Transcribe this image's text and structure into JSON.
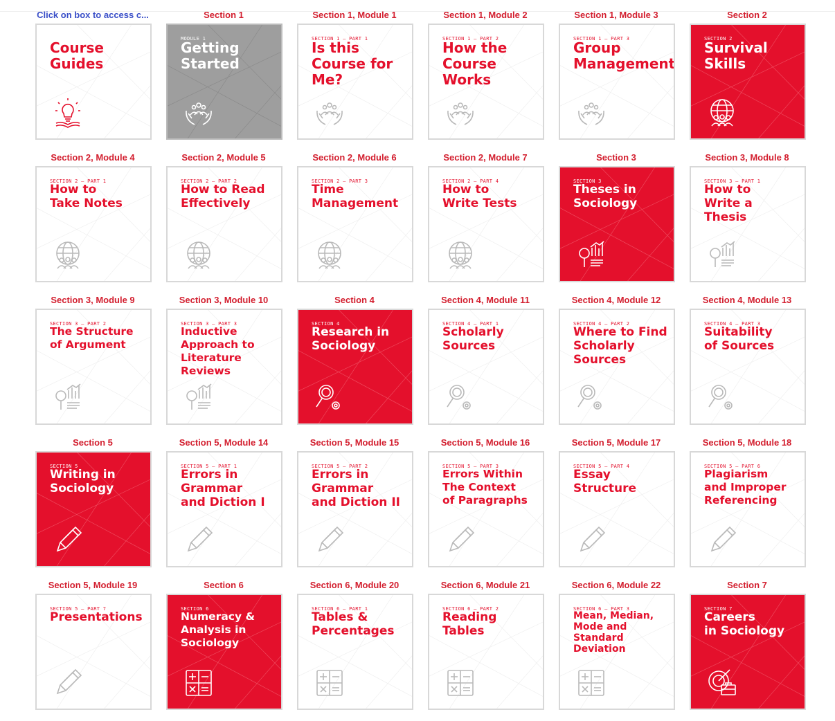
{
  "header_link": "Click on box to access c...",
  "icon_colors": {
    "red": "#e4102c",
    "light": "#b9b9b9",
    "white": "#ffffff"
  },
  "cells": [
    {
      "label": "Click on box to access c...",
      "kicker": "",
      "title": "Course\nGuides",
      "style": "white",
      "icon": "lightbulb-book-icon",
      "size": "big"
    },
    {
      "label": "Section 1",
      "kicker": "MODULE 1",
      "title": "Getting\nStarted",
      "style": "grey",
      "icon": "people-hands-icon",
      "size": "big"
    },
    {
      "label": "Section 1, Module 1",
      "kicker": "SECTION 1 – PART 1",
      "title": "Is this\nCourse for\nMe?",
      "style": "white",
      "icon": "people-hands-icon",
      "size": "big"
    },
    {
      "label": "Section 1, Module 2",
      "kicker": "SECTION 1 – PART 2",
      "title": "How the\nCourse\nWorks",
      "style": "white",
      "icon": "people-hands-icon",
      "size": "big"
    },
    {
      "label": "Section 1, Module 3",
      "kicker": "SECTION 1 – PART 3",
      "title": "Group\nManagement",
      "style": "white",
      "icon": "people-hands-icon",
      "size": "big"
    },
    {
      "label": "Section 2",
      "kicker": "SECTION 2",
      "title": "Survival\nSkills",
      "style": "red",
      "icon": "globe-people-icon",
      "size": "big"
    },
    {
      "label": "Section 2, Module 4",
      "kicker": "SECTION 2 – PART 1",
      "title": "How to\nTake Notes",
      "style": "white",
      "icon": "globe-people-icon",
      "size": "md"
    },
    {
      "label": "Section 2, Module 5",
      "kicker": "SECTION 2 – PART 2",
      "title": "How to Read\nEffectively",
      "style": "white",
      "icon": "globe-people-icon",
      "size": "md"
    },
    {
      "label": "Section 2, Module 6",
      "kicker": "SECTION 2 – PART 3",
      "title": "Time\nManagement",
      "style": "white",
      "icon": "globe-people-icon",
      "size": "md"
    },
    {
      "label": "Section 2, Module 7",
      "kicker": "SECTION 2 – PART 4",
      "title": "How to\nWrite Tests",
      "style": "white",
      "icon": "globe-people-icon",
      "size": "md"
    },
    {
      "label": "Section 3",
      "kicker": "SECTION 3",
      "title": "Theses in\nSociology",
      "style": "red",
      "icon": "magnifier-chart-icon",
      "size": "md"
    },
    {
      "label": "Section 3, Module 8",
      "kicker": "SECTION 3 – PART 1",
      "title": "How to\nWrite a\nThesis",
      "style": "white",
      "icon": "magnifier-chart-icon",
      "size": "md"
    },
    {
      "label": "Section 3, Module 9",
      "kicker": "SECTION 3 – PART 2",
      "title": "The Structure\nof Argument",
      "style": "white",
      "icon": "magnifier-chart-icon",
      "size": "sm"
    },
    {
      "label": "Section 3, Module 10",
      "kicker": "SECTION 3 – PART 3",
      "title": "Inductive\nApproach to\nLiterature\nReviews",
      "style": "white",
      "icon": "magnifier-chart-icon",
      "size": "sm"
    },
    {
      "label": "Section 4",
      "kicker": "SECTION 4",
      "title": "Research in\nSociology",
      "style": "red",
      "icon": "magnifier-gear-icon",
      "size": "md"
    },
    {
      "label": "Section 4, Module 11",
      "kicker": "SECTION 4 – PART 1",
      "title": "Scholarly\nSources",
      "style": "white",
      "icon": "magnifier-gear-icon",
      "size": "md"
    },
    {
      "label": "Section 4, Module 12",
      "kicker": "SECTION 4 – PART 2",
      "title": "Where to Find\nScholarly\nSources",
      "style": "white",
      "icon": "magnifier-gear-icon",
      "size": "md"
    },
    {
      "label": "Section 4, Module 13",
      "kicker": "SECTION 4 – PART 3",
      "title": "Suitability\nof Sources",
      "style": "white",
      "icon": "magnifier-gear-icon",
      "size": "md"
    },
    {
      "label": "Section 5",
      "kicker": "SECTION 5",
      "title": "Writing in\nSociology",
      "style": "red",
      "icon": "pencil-icon",
      "size": "md"
    },
    {
      "label": "Section 5, Module 14",
      "kicker": "SECTION 5 – PART 1",
      "title": "Errors in\nGrammar\nand Diction I",
      "style": "white",
      "icon": "pencil-icon",
      "size": "md"
    },
    {
      "label": "Section 5, Module 15",
      "kicker": "SECTION 5 – PART 2",
      "title": "Errors in\nGrammar\nand Diction II",
      "style": "white",
      "icon": "pencil-icon",
      "size": "md"
    },
    {
      "label": "Section 5, Module 16",
      "kicker": "SECTION 5 – PART 3",
      "title": "Errors Within\nThe Context\nof Paragraphs",
      "style": "white",
      "icon": "pencil-icon",
      "size": "sm"
    },
    {
      "label": "Section 5, Module 17",
      "kicker": "SECTION 5 – PART 4",
      "title": "Essay\nStructure",
      "style": "white",
      "icon": "pencil-icon",
      "size": "md"
    },
    {
      "label": "Section 5, Module 18",
      "kicker": "SECTION 5 – PART 6",
      "title": "Plagiarism\nand Improper\nReferencing",
      "style": "white",
      "icon": "pencil-icon",
      "size": "sm"
    },
    {
      "label": "Section 5, Module 19",
      "kicker": "SECTION 5 – PART 7",
      "title": "Presentations",
      "style": "white",
      "icon": "pencil-icon",
      "size": "md"
    },
    {
      "label": "Section 6",
      "kicker": "SECTION 6",
      "title": "Numeracy &\nAnalysis in\nSociology",
      "style": "red",
      "icon": "calculator-icon",
      "size": "sm"
    },
    {
      "label": "Section 6, Module 20",
      "kicker": "SECTION 6 – PART 1",
      "title": "Tables &\nPercentages",
      "style": "white",
      "icon": "calculator-icon",
      "size": "md"
    },
    {
      "label": "Section 6, Module 21",
      "kicker": "SECTION 6 – PART 2",
      "title": "Reading\nTables",
      "style": "white",
      "icon": "calculator-icon",
      "size": "md"
    },
    {
      "label": "Section 6, Module 22",
      "kicker": "SECTION 6 – PART 3",
      "title": "Mean, Median,\nMode and\nStandard\nDeviation",
      "style": "white",
      "icon": "calculator-icon",
      "size": "xs"
    },
    {
      "label": "Section 7",
      "kicker": "SECTION 7",
      "title": "Careers\nin Sociology",
      "style": "red",
      "icon": "briefcase-target-icon",
      "size": "md"
    }
  ]
}
